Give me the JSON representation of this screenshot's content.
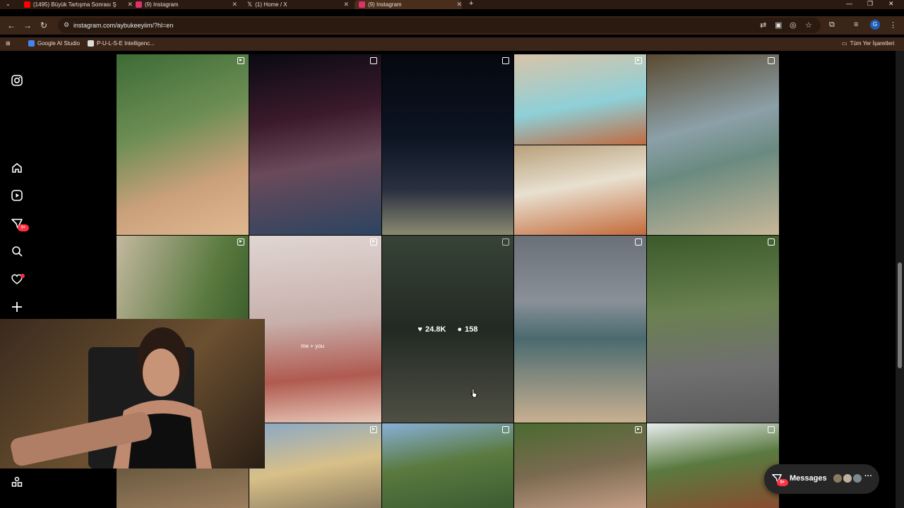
{
  "browser": {
    "tabs": [
      {
        "label": "(1495) Büyük Tartışma Sonrası Ş",
        "favicon_color": "#ff0000",
        "icon": "youtube-icon"
      },
      {
        "label": "(9) Instagram",
        "favicon_color": "#e1306c",
        "icon": "instagram-icon"
      },
      {
        "label": "(1) Home / X",
        "favicon_color": "#000000",
        "icon": "x-icon"
      },
      {
        "label": "(9) Instagram",
        "favicon_color": "#e1306c",
        "icon": "instagram-icon"
      }
    ],
    "active_tab": 3,
    "url": "instagram.com/aybukeeyiim/?hl=en",
    "bookmarks": [
      {
        "label": "Google AI Studio",
        "icon": "google-ai-studio-icon"
      },
      {
        "label": "P-U-L-S-E Intelligenc...",
        "icon": "pulse-icon"
      }
    ],
    "all_bookmarks_label": "Tüm Yer İşaretleri",
    "profile_initial": "G"
  },
  "sidebar": {
    "notification_badge": "9+"
  },
  "grid": {
    "hover_post": {
      "likes": "24.8K",
      "comments": "158"
    },
    "reel_caption": "me + you"
  },
  "messages": {
    "label": "Messages",
    "badge": "9+"
  },
  "colors": {
    "accent": "#ff3040",
    "browser_bg": "#3b2518",
    "page_bg": "#000000"
  }
}
